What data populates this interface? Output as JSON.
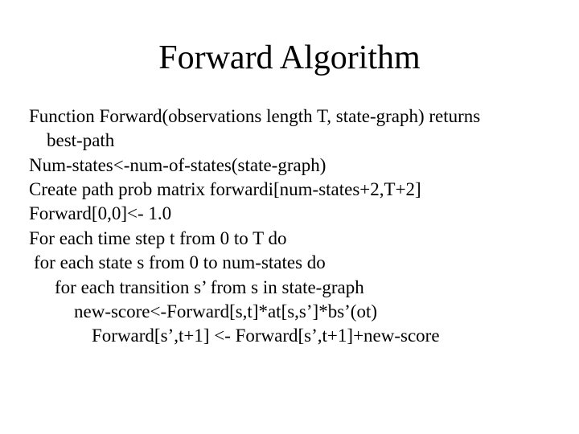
{
  "title": "Forward Algorithm",
  "lines": {
    "l1": "Function Forward(observations length T, state-graph) returns",
    "l1b": "best-path",
    "l2": "Num-states<-num-of-states(state-graph)",
    "l3": "Create path prob matrix forwardi[num-states+2,T+2]",
    "l4": "Forward[0,0]<- 1.0",
    "l5": "For each time step t from 0 to T do",
    "l6": "for each state s from 0 to num-states do",
    "l7": "for each transition s’ from s in state-graph",
    "l8": "new-score<-Forward[s,t]*at[s,s’]*bs’(ot)",
    "l9": "Forward[s’,t+1] <- Forward[s’,t+1]+new-score"
  }
}
